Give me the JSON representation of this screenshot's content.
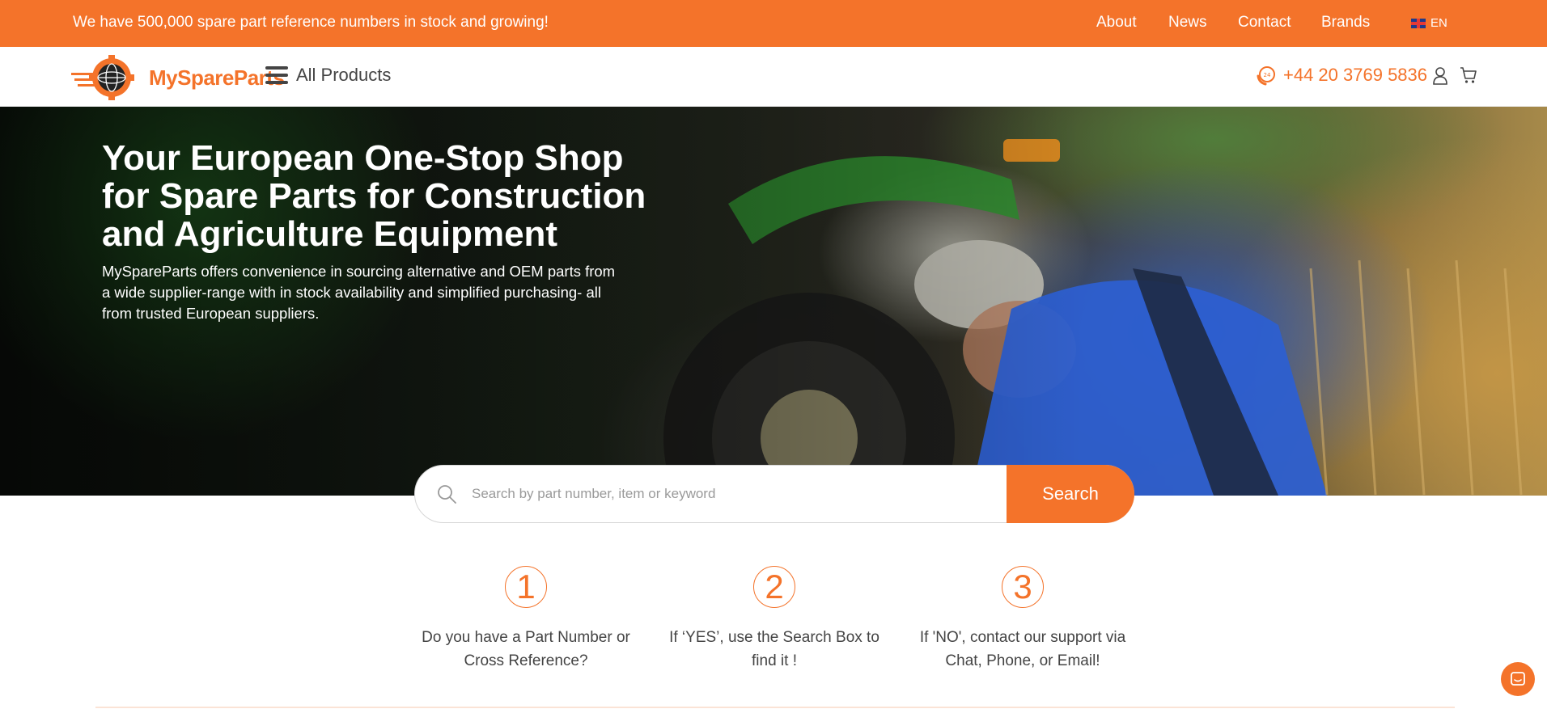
{
  "topbar": {
    "promo": "We have 500,000 spare part reference numbers in stock and growing!",
    "nav": [
      {
        "label": "About"
      },
      {
        "label": "News"
      },
      {
        "label": "Contact"
      },
      {
        "label": "Brands"
      }
    ],
    "language": "EN"
  },
  "header": {
    "logo_text": "MySpareParts",
    "menu_label": "All Products",
    "phone": "+44 20 3769 5836"
  },
  "hero": {
    "title": "Your European One-Stop Shop for Spare Parts for Construction and Agriculture Equipment",
    "subtitle": "MySpareParts offers convenience in sourcing alternative and OEM parts from a wide supplier-range with in stock availability and simplified purchasing- all from trusted European suppliers."
  },
  "search": {
    "placeholder": "Search by part number, item or keyword",
    "button_label": "Search"
  },
  "steps": [
    {
      "number": "1",
      "text": "Do you have a Part Number or Cross Reference?"
    },
    {
      "number": "2",
      "text": "If ‘YES’, use the Search Box to find it !"
    },
    {
      "number": "3",
      "text": "If 'NO', contact our support via Chat, Phone, or Email!"
    }
  ],
  "colors": {
    "accent": "#f4732a",
    "text": "#444444"
  }
}
